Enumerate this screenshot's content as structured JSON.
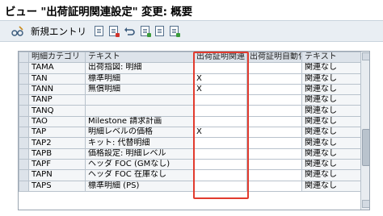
{
  "window": {
    "title": "ビュー \"出荷証明関連設定\" 変更: 概要"
  },
  "toolbar": {
    "new_entry_label": "新規エントリ",
    "icons": [
      "edit-glasses-icon",
      "copy-icon",
      "delete-icon",
      "undo-icon",
      "select-all-icon",
      "select-block-icon",
      "deselect-icon"
    ]
  },
  "table": {
    "columns": [
      "明細カテゴリ",
      "テキスト",
      "出荷証明関連",
      "出荷証明自動化",
      "テキスト"
    ],
    "rows": [
      {
        "key": "TAMA",
        "text": "出荷指図: 明細",
        "relevant": "",
        "auto": "",
        "auto_text": "関連なし"
      },
      {
        "key": "TAN",
        "text": "標準明細",
        "relevant": "X",
        "auto": "",
        "auto_text": "関連なし"
      },
      {
        "key": "TANN",
        "text": "無償明細",
        "relevant": "X",
        "auto": "",
        "auto_text": "関連なし"
      },
      {
        "key": "TANP",
        "text": "",
        "relevant": "",
        "auto": "",
        "auto_text": "関連なし"
      },
      {
        "key": "TANQ",
        "text": "",
        "relevant": "",
        "auto": "",
        "auto_text": "関連なし"
      },
      {
        "key": "TAO",
        "text": "Milestone 請求計画",
        "relevant": "",
        "auto": "",
        "auto_text": "関連なし"
      },
      {
        "key": "TAP",
        "text": "明細レベルの価格",
        "relevant": "X",
        "auto": "",
        "auto_text": "関連なし"
      },
      {
        "key": "TAP2",
        "text": "キット: 代替明細",
        "relevant": "",
        "auto": "",
        "auto_text": "関連なし"
      },
      {
        "key": "TAPB",
        "text": "価格設定: 明細レベル",
        "relevant": "",
        "auto": "",
        "auto_text": "関連なし"
      },
      {
        "key": "TAPF",
        "text": "ヘッダ FOC (GMなし)",
        "relevant": "",
        "auto": "",
        "auto_text": "関連なし"
      },
      {
        "key": "TAPN",
        "text": "ヘッダ FOC 在庫なし",
        "relevant": "",
        "auto": "",
        "auto_text": "関連なし"
      },
      {
        "key": "TAPS",
        "text": "標準明細 (PS)",
        "relevant": "",
        "auto": "",
        "auto_text": "関連なし"
      }
    ]
  },
  "colors": {
    "highlight": "#e23b2e",
    "header_bg": "#dde3ea",
    "toolbar_bg": "#e9eef3"
  }
}
